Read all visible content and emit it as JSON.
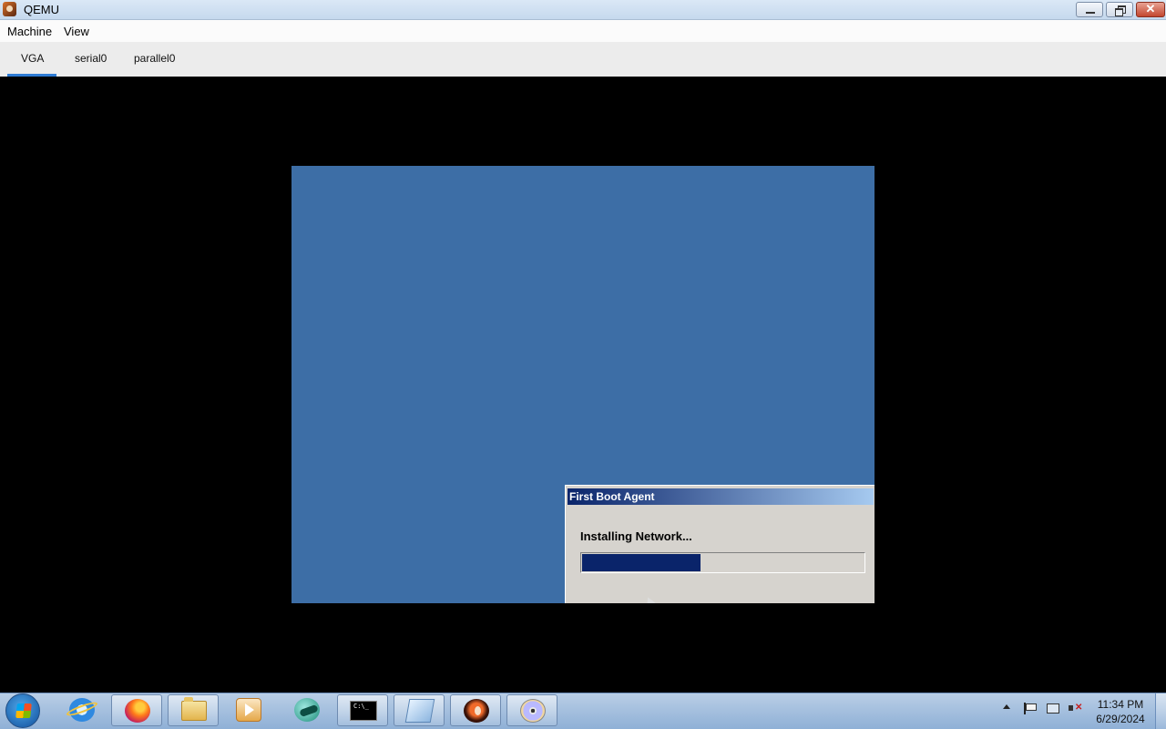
{
  "window": {
    "title": "QEMU"
  },
  "menu": {
    "items": [
      "Machine",
      "View"
    ]
  },
  "tabs": [
    {
      "label": "VGA",
      "active": true
    },
    {
      "label": "serial0",
      "active": false
    },
    {
      "label": "parallel0",
      "active": false
    }
  ],
  "guest": {
    "desktop_color": "#3d6ea6",
    "dialog": {
      "title": "First Boot Agent",
      "message": "Installing Network...",
      "progress_fraction": 0.42
    }
  },
  "taskbar": {
    "pinned": [
      {
        "name": "internet-explorer-icon"
      },
      {
        "name": "firefox-icon"
      },
      {
        "name": "file-explorer-icon"
      },
      {
        "name": "media-player-icon"
      },
      {
        "name": "green-app-icon"
      },
      {
        "name": "command-prompt-icon",
        "glyph": "C:\\_"
      },
      {
        "name": "notepad-icon"
      },
      {
        "name": "qemu-icon"
      },
      {
        "name": "disc-icon"
      }
    ],
    "clock": {
      "time": "11:34 PM",
      "date": "6/29/2024"
    }
  },
  "colors": {
    "accent": "#2e7bd4",
    "dialog_title": "#0a246a",
    "progress": "#0a246a"
  }
}
